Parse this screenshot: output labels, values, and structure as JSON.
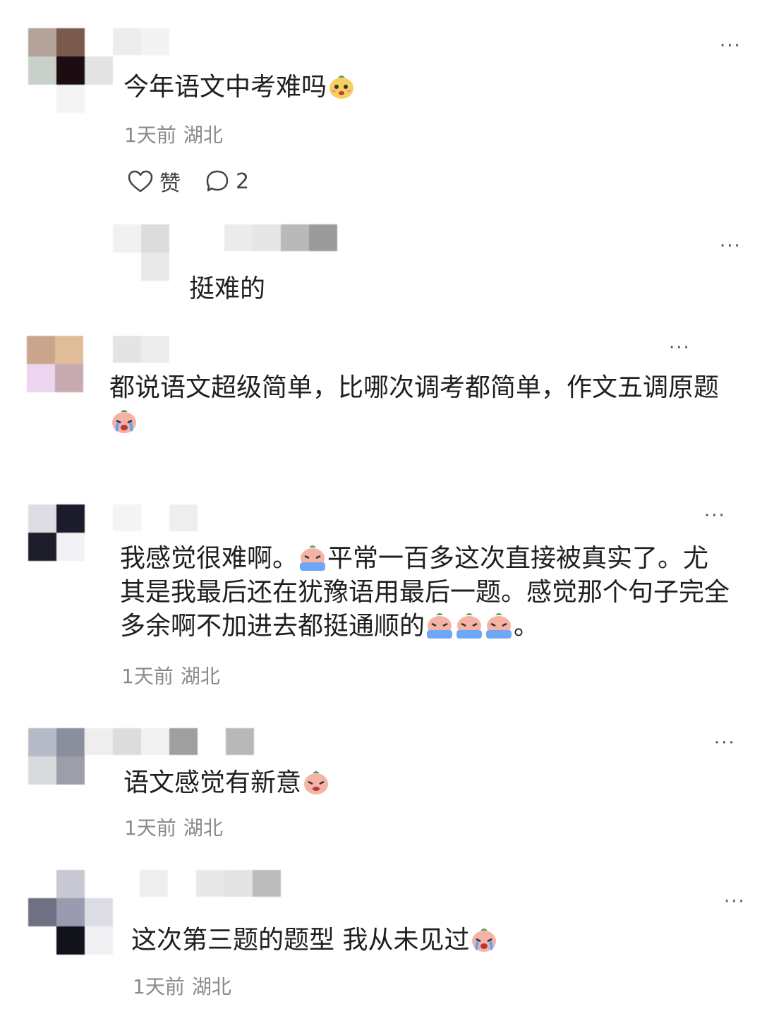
{
  "comments": [
    {
      "text": "今年语文中考难吗",
      "time": "1天前",
      "location": "湖北",
      "like_label": "赞",
      "reply_count": "2",
      "more": "···"
    },
    {
      "text": "挺难的",
      "more": "···"
    },
    {
      "text": "都说语文超级简单，比哪次调考都简单，作文五调原题",
      "more": "···"
    },
    {
      "line1": "我感觉很难啊。",
      "line1b": "平常一百多这次直接被真实了。尤",
      "line2": "其是我最后还在犹豫语用最后一题。感觉那个句子完全",
      "line3": "多余啊不加进去都挺通顺的",
      "line3end": "。",
      "time": "1天前",
      "location": "湖北",
      "more": "···"
    },
    {
      "text": "语文感觉有新意",
      "time": "1天前",
      "location": "湖北",
      "more": "···"
    },
    {
      "text": "这次第三题的题型 我从未见过",
      "time": "1天前",
      "location": "湖北",
      "more": "···"
    }
  ],
  "icons": {
    "more": "more-dots-icon",
    "like": "heart-icon",
    "reply": "comment-bubble-icon",
    "emoji_sweat": "emoji-embarrassed-face-icon",
    "emoji_cry": "emoji-crying-face-icon"
  }
}
